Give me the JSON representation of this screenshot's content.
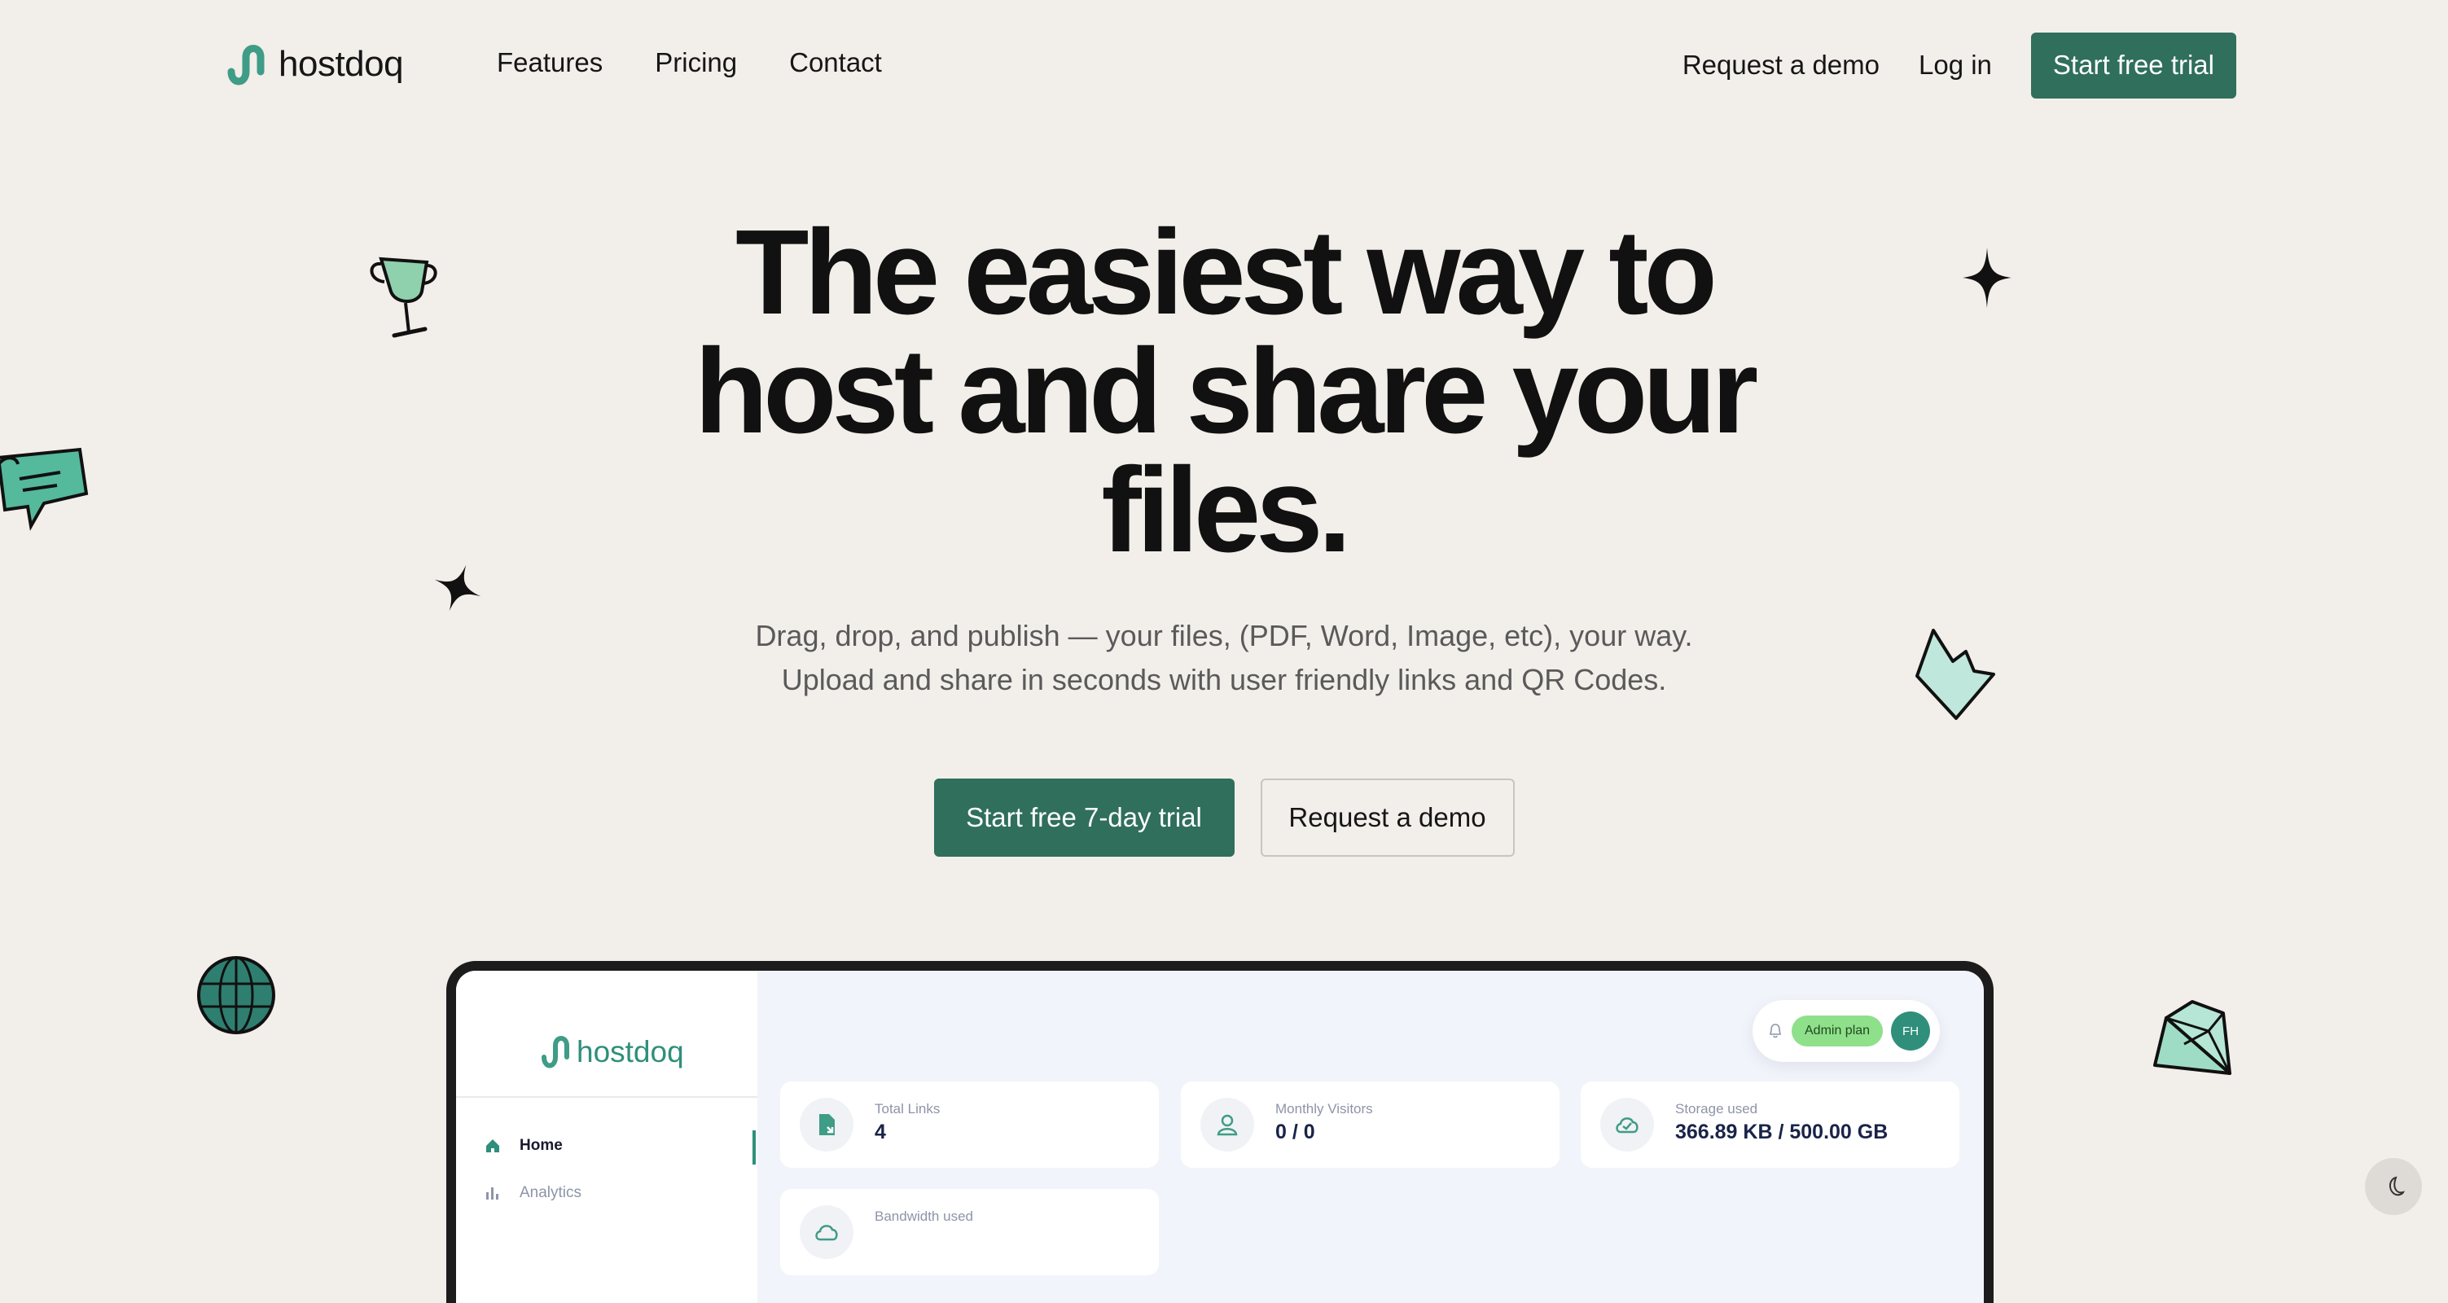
{
  "brand": {
    "name": "hostdoq",
    "color": "#2f6f5b",
    "accent": "#2f8f7b"
  },
  "nav": {
    "links": [
      "Features",
      "Pricing",
      "Contact"
    ],
    "request_demo": "Request a demo",
    "login": "Log in",
    "cta": "Start free trial"
  },
  "hero": {
    "headline_lines": [
      "The easiest way to",
      "host and share your",
      "files."
    ],
    "sub_lines": [
      "Drag, drop, and publish — your files, (PDF, Word, Image, etc), your way.",
      "Upload and share in seconds with user friendly links and QR Codes."
    ],
    "primary_button": "Start free 7-day trial",
    "secondary_button": "Request a demo"
  },
  "dashboard": {
    "logo": "hostdoq",
    "sidebar": [
      {
        "label": "Home",
        "icon": "home-icon",
        "active": true
      },
      {
        "label": "Analytics",
        "icon": "bar-chart-icon",
        "active": false
      }
    ],
    "plan_badge": "Admin plan",
    "avatar_initials": "FH",
    "stats": [
      {
        "label": "Total Links",
        "value": "4",
        "icon": "file-link-icon"
      },
      {
        "label": "Monthly Visitors",
        "value": "0 / 0",
        "icon": "user-icon"
      },
      {
        "label": "Storage used",
        "value": "366.89 KB / 500.00 GB",
        "icon": "cloud-check-icon"
      },
      {
        "label": "Bandwidth used",
        "value": "",
        "icon": "cloud-icon"
      }
    ]
  },
  "decorations": [
    "trophy-icon",
    "chat-bubble-icon",
    "sparkle-icon",
    "sparkle-icon",
    "crown-icon",
    "globe-icon",
    "diamond-icon"
  ],
  "theme_toggle_icon": "moon-icon"
}
